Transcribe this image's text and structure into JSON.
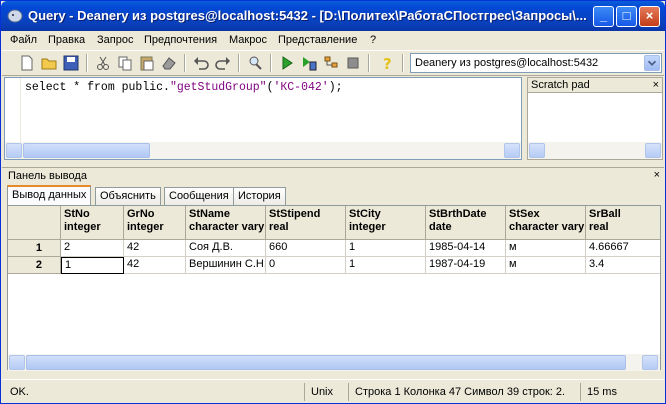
{
  "window": {
    "title": "Query - Deanery из postgres@localhost:5432 - [D:\\Политех\\РаботаСПостгрес\\Запросы\\..."
  },
  "menu": [
    "Файл",
    "Правка",
    "Запрос",
    "Предпочтения",
    "Макрос",
    "Представление",
    "?"
  ],
  "toolbar": {
    "connection": "Deanery из postgres@localhost:5432"
  },
  "editor": {
    "sql_prefix": "select * from public.",
    "sql_func": "\"getStudGroup\"",
    "sql_paren_open": "(",
    "sql_arg": "'КС-042'",
    "sql_suffix": ");"
  },
  "scratch": {
    "title": "Scratch pad",
    "close": "×"
  },
  "output": {
    "title": "Панель вывода",
    "close": "×",
    "tabs": [
      "Вывод данных",
      "Объяснить",
      "Сообщения",
      "История"
    ],
    "columns": [
      {
        "name": "StNo",
        "type": "integer"
      },
      {
        "name": "GrNo",
        "type": "integer"
      },
      {
        "name": "StName",
        "type": "character varying"
      },
      {
        "name": "StStipend",
        "type": "real"
      },
      {
        "name": "StCity",
        "type": "integer"
      },
      {
        "name": "StBrthDate",
        "type": "date"
      },
      {
        "name": "StSex",
        "type": "character varying"
      },
      {
        "name": "SrBall",
        "type": "real"
      }
    ],
    "rows": [
      {
        "num": "1",
        "cells": [
          "2",
          "42",
          "Соя Д.В.",
          "660",
          "1",
          "1985-04-14",
          "м",
          "4.66667"
        ]
      },
      {
        "num": "2",
        "cells": [
          "1",
          "42",
          "Вершинин С.Н.",
          "0",
          "1",
          "1987-04-19",
          "м",
          "3.4"
        ]
      }
    ]
  },
  "status": {
    "state": "OK.",
    "eol": "Unix",
    "position": "Строка 1 Колонка 47 Символ 39",
    "rows": "строк: 2.",
    "time": "15 ms"
  },
  "colors": {
    "title_bar": "#0a3fb8",
    "active_tab": "#e68b2c"
  }
}
